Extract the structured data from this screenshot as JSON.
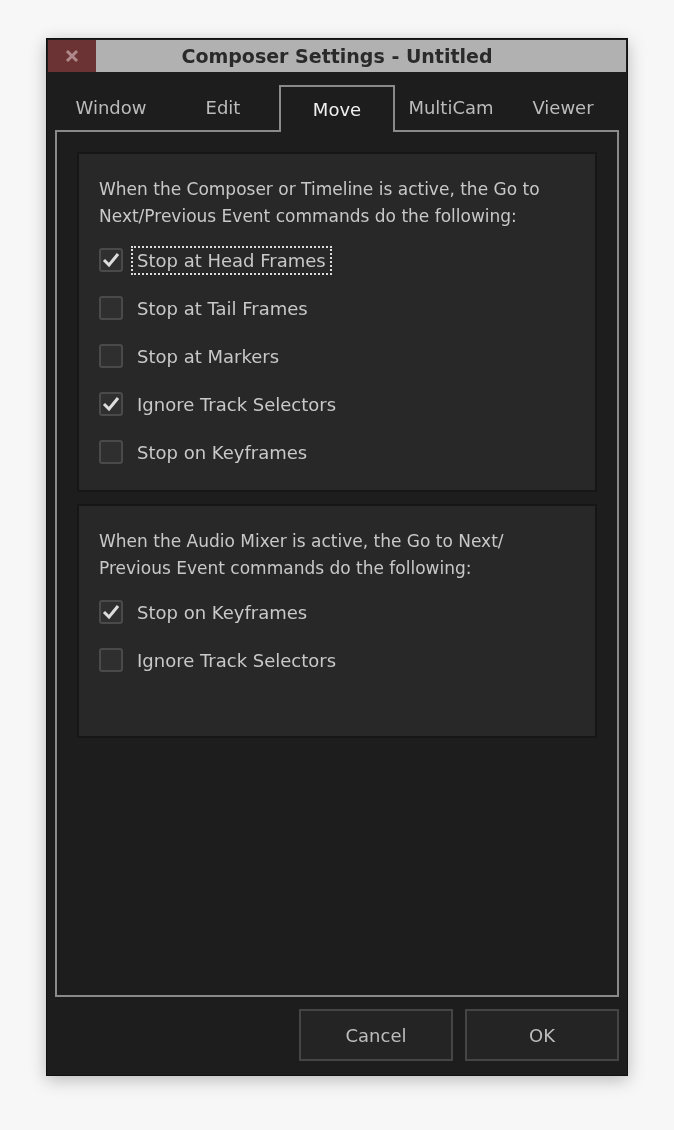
{
  "window": {
    "title": "Composer Settings - Untitled"
  },
  "tabs": [
    {
      "label": "Window",
      "selected": false
    },
    {
      "label": "Edit",
      "selected": false
    },
    {
      "label": "Move",
      "selected": true
    },
    {
      "label": "MultiCam",
      "selected": false
    },
    {
      "label": "Viewer",
      "selected": false
    }
  ],
  "groups": [
    {
      "description": "When the Composer or Timeline is active, the Go to Next/Previous Event commands do the following:",
      "options": [
        {
          "label": "Stop at Head Frames",
          "checked": true,
          "focused": true
        },
        {
          "label": "Stop at Tail Frames",
          "checked": false,
          "focused": false
        },
        {
          "label": "Stop at Markers",
          "checked": false,
          "focused": false
        },
        {
          "label": "Ignore Track Selectors",
          "checked": true,
          "focused": false
        },
        {
          "label": "Stop on Keyframes",
          "checked": false,
          "focused": false
        }
      ]
    },
    {
      "description": "When the Audio Mixer is active, the Go to Next/ Previous Event commands do the following:",
      "options": [
        {
          "label": "Stop on Keyframes",
          "checked": true,
          "focused": false
        },
        {
          "label": "Ignore Track Selectors",
          "checked": false,
          "focused": false
        }
      ]
    }
  ],
  "buttons": [
    "Cancel",
    "OK"
  ]
}
